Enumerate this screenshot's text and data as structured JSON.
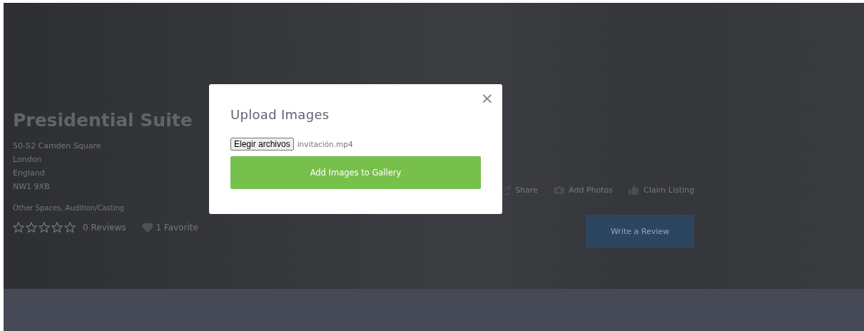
{
  "listing": {
    "title": "Presidential Suite",
    "address_lines": [
      "50-52 Camden Square",
      "London",
      "England",
      "NW1 9XB"
    ],
    "categories": "Other Spaces, Audition/Casting",
    "stars": 0,
    "reviews": "0 Reviews",
    "favorites": "1 Favorite",
    "actions": [
      {
        "kind": "share",
        "label": "Share"
      },
      {
        "kind": "camera",
        "label": "Add Photos"
      },
      {
        "kind": "thumb",
        "label": "Claim Listing"
      }
    ],
    "review_button": "Write a Review"
  },
  "modal": {
    "title": "Upload Images",
    "close": "×",
    "file_button": "Elegir archivos",
    "file_name": "invitación.mp4",
    "submit": "Add Images to Gallery"
  }
}
